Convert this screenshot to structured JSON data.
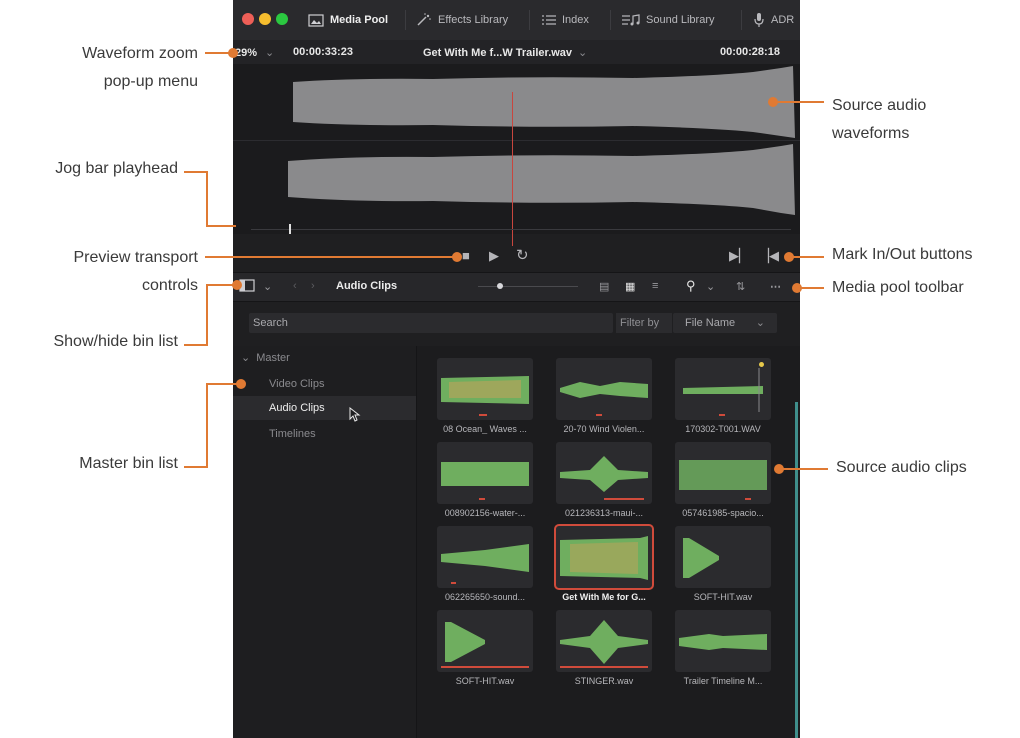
{
  "tabs": [
    {
      "label": "Media Pool",
      "icon": "media-pool-icon",
      "active": true
    },
    {
      "label": "Effects Library",
      "icon": "effects-wand-icon"
    },
    {
      "label": "Index",
      "icon": "index-list-icon"
    },
    {
      "label": "Sound Library",
      "icon": "sound-library-icon"
    },
    {
      "label": "ADR",
      "icon": "microphone-icon"
    }
  ],
  "viewer": {
    "zoom": "29%",
    "timecode_left": "00:00:33:23",
    "clip_name": "Get With Me f...W Trailer.wav",
    "timecode_right": "00:00:28:18"
  },
  "toolbar": {
    "bin_name": "Audio Clips"
  },
  "search": {
    "placeholder": "Search",
    "filter_label": "Filter by",
    "filter_value": "File Name"
  },
  "bins": {
    "root": "Master",
    "items": [
      "Video Clips",
      "Audio Clips",
      "Timelines"
    ]
  },
  "clips": [
    "08 Ocean_ Waves ...",
    "20-70 Wind Violen...",
    "170302-T001.WAV",
    "008902156-water-...",
    "021236313-maui-...",
    "057461985-spacio...",
    "062265650-sound...",
    "Get With Me for G...",
    "SOFT-HIT.wav",
    "SOFT-HIT.wav",
    "STINGER.wav",
    "Trailer Timeline M..."
  ],
  "callouts": {
    "waveform_zoom": "Waveform zoom\npop-up menu",
    "jog_bar": "Jog bar playhead",
    "transport": "Preview transport\ncontrols",
    "show_hide": "Show/hide bin list",
    "master_bin": "Master bin list",
    "source_waveforms": "Source audio\nwaveforms",
    "mark_in_out": "Mark In/Out buttons",
    "toolbar": "Media pool toolbar",
    "source_clips": "Source audio clips"
  },
  "colors": {
    "accent": "#e07a33",
    "selection": "#d04b3b",
    "waveform_green": "#6fae5f",
    "waveform_gold": "#c4a25a"
  }
}
